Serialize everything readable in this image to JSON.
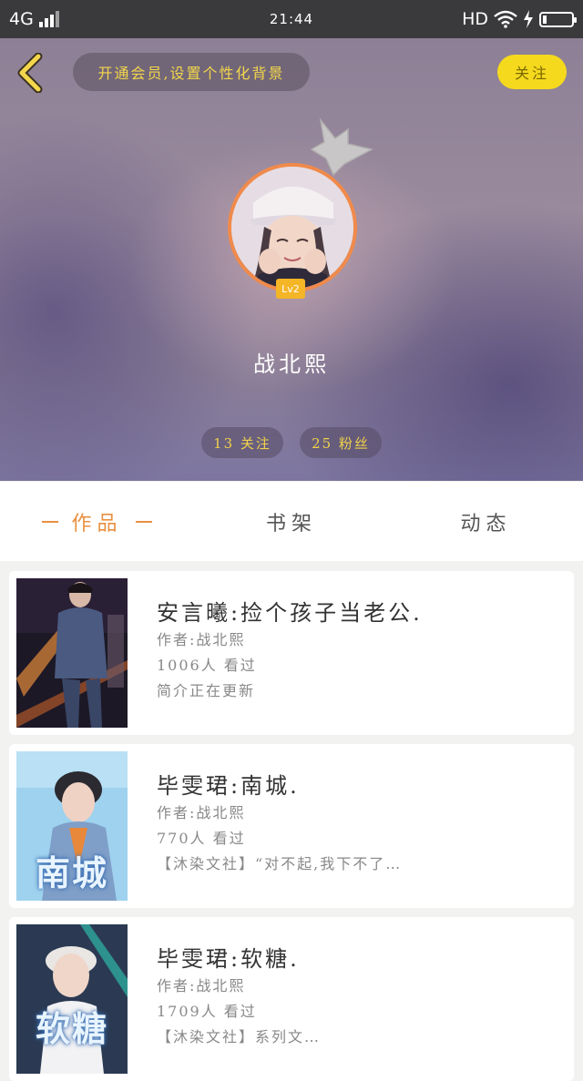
{
  "status_bar": {
    "network": "4G",
    "time": "21:44",
    "hd": "HD"
  },
  "header": {
    "vip_promo": "开通会员,设置个性化背景",
    "follow_label": "关注",
    "level": "Lv2",
    "username": "战北熙",
    "following": "13 关注",
    "fans": "25 粉丝"
  },
  "tabs": [
    {
      "label": "作品",
      "active": true
    },
    {
      "label": "书架",
      "active": false
    },
    {
      "label": "动态",
      "active": false
    }
  ],
  "books": [
    {
      "title": "安言曦:捡个孩子当老公.",
      "author": "作者:战北熙",
      "views": "1006人 看过",
      "intro": "简介正在更新",
      "cover_text": ""
    },
    {
      "title": "毕雯珺:南城.",
      "author": "作者:战北熙",
      "views": "770人 看过",
      "intro": "【沐染文社】“对不起,我下不了…",
      "cover_text": "南城"
    },
    {
      "title": "毕雯珺:软糖.",
      "author": "作者:战北熙",
      "views": "1709人 看过",
      "intro": "【沐染文社】系列文…",
      "cover_text": "软糖"
    }
  ],
  "colors": {
    "accent": "#e8903f",
    "follow_button": "#f5d91d",
    "pill_text": "#f1d24a",
    "avatar_ring": "#f08a4b"
  }
}
